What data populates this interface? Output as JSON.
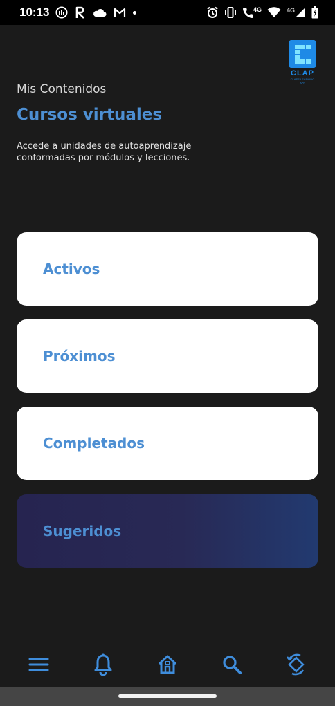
{
  "status_bar": {
    "time": "10:13",
    "network_label_1": "4G",
    "network_label_2": "4G"
  },
  "logo": {
    "text": "CLAP",
    "tagline": "CLASS LEARNING APP"
  },
  "header": {
    "subtitle": "Mis Contenidos",
    "title": "Cursos virtuales",
    "description": "Accede a unidades de autoaprendizaje conformadas por módulos y lecciones."
  },
  "cards": [
    {
      "label": "Activos"
    },
    {
      "label": "Próximos"
    },
    {
      "label": "Completados"
    },
    {
      "label": "Sugeridos"
    }
  ],
  "bottom_nav": {
    "icons": [
      "menu-icon",
      "bell-icon",
      "home-icon",
      "search-icon",
      "rotate-icon"
    ],
    "accent_color": "#3f8ddc"
  },
  "colors": {
    "background": "#1b1b1b",
    "accent": "#4d8fd3",
    "card": "#ffffff",
    "suggested_card_start": "#262450",
    "suggested_card_end": "#223a70"
  }
}
